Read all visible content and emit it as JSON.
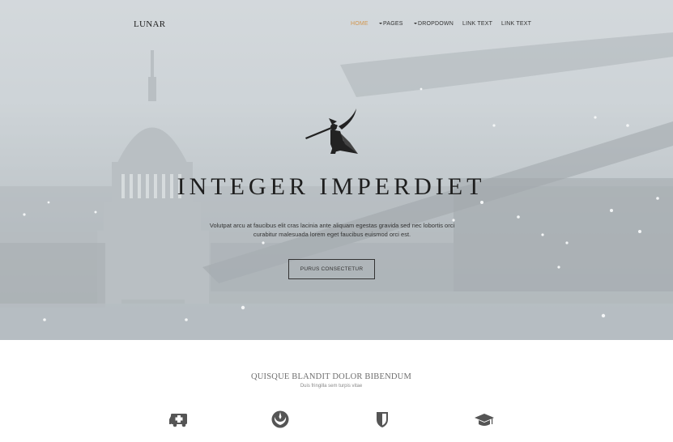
{
  "header": {
    "brand": "LUNAR",
    "nav": [
      {
        "label": "HOME",
        "active": true,
        "caret": false
      },
      {
        "label": "PAGES",
        "active": false,
        "caret": true
      },
      {
        "label": "DROPDOWN",
        "active": false,
        "caret": true
      },
      {
        "label": "LINK TEXT",
        "active": false,
        "caret": false
      },
      {
        "label": "LINK TEXT",
        "active": false,
        "caret": false
      }
    ]
  },
  "hero": {
    "title": "INTEGER IMPERDIET",
    "text": "Volutpat arcu at faucibus elit cras lacinia ante aliquam egestas gravida sed nec lobortis orci curabitur malesuada lorem eget faucibus euismod orci est.",
    "button": "PURUS CONSECTETUR",
    "logo_icon": "archer-logo-icon"
  },
  "features": {
    "title": "QUISQUE BLANDIT DOLOR BIBENDUM",
    "subtitle": "Duis fringilla sem turpis vitae",
    "items": [
      {
        "icon": "ambulance-icon"
      },
      {
        "icon": "rebel-icon"
      },
      {
        "icon": "shield-icon"
      },
      {
        "icon": "graduation-cap-icon"
      }
    ]
  },
  "colors": {
    "accent": "#d2964e",
    "text": "#1e1e1e",
    "feature_label": "#d2b27e"
  }
}
